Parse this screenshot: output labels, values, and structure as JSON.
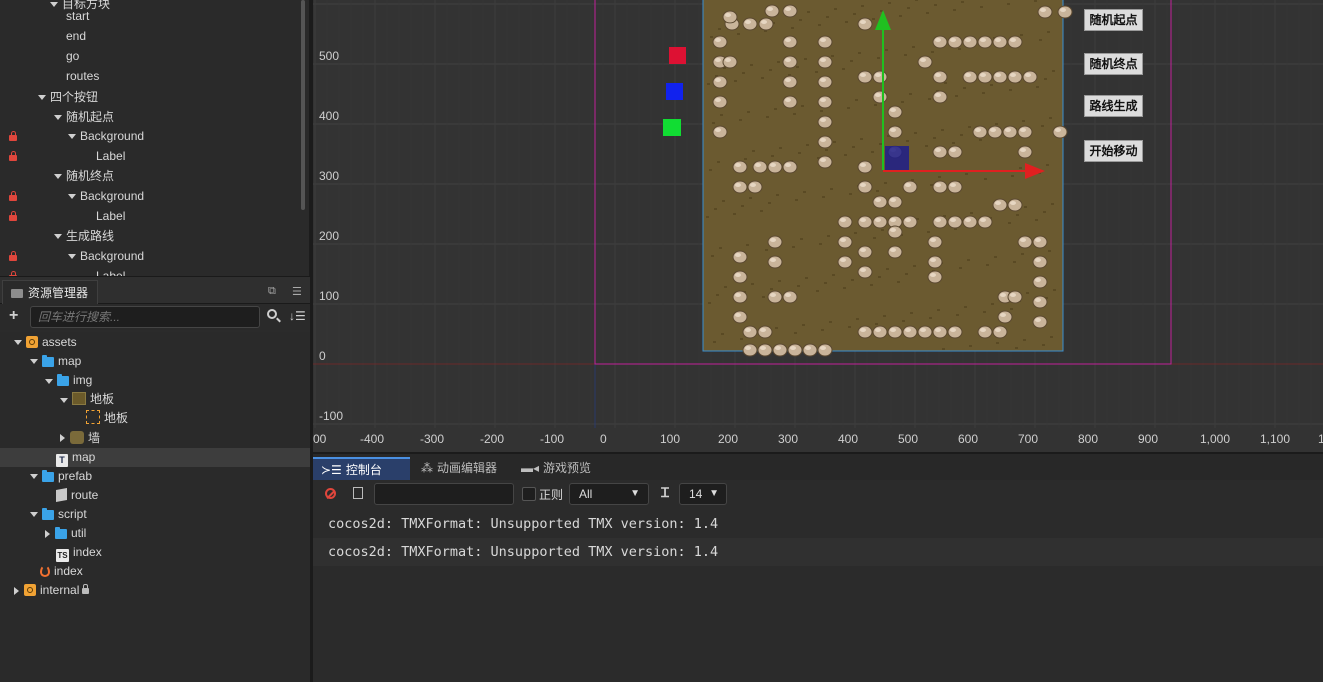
{
  "hierarchy": {
    "rows": [
      {
        "label": "目标方块",
        "indent": 50,
        "expanded": true,
        "locked": false,
        "partial": true
      },
      {
        "label": "start",
        "indent": 66,
        "expanded": null,
        "locked": false
      },
      {
        "label": "end",
        "indent": 66,
        "expanded": null,
        "locked": false
      },
      {
        "label": "go",
        "indent": 66,
        "expanded": null,
        "locked": false
      },
      {
        "label": "routes",
        "indent": 66,
        "expanded": null,
        "locked": false
      },
      {
        "label": "四个按钮",
        "indent": 38,
        "expanded": true,
        "locked": false
      },
      {
        "label": "随机起点",
        "indent": 54,
        "expanded": true,
        "locked": false
      },
      {
        "label": "Background",
        "indent": 68,
        "expanded": true,
        "locked": true
      },
      {
        "label": "Label",
        "indent": 96,
        "expanded": null,
        "locked": true
      },
      {
        "label": "随机终点",
        "indent": 54,
        "expanded": true,
        "locked": false
      },
      {
        "label": "Background",
        "indent": 68,
        "expanded": true,
        "locked": true
      },
      {
        "label": "Label",
        "indent": 96,
        "expanded": null,
        "locked": true
      },
      {
        "label": "生成路线",
        "indent": 54,
        "expanded": true,
        "locked": false
      },
      {
        "label": "Background",
        "indent": 68,
        "expanded": true,
        "locked": true
      },
      {
        "label": "Label",
        "indent": 96,
        "expanded": null,
        "locked": true
      }
    ]
  },
  "assets_panel": {
    "tab_label": "资源管理器",
    "search_placeholder": "回车进行搜索...",
    "rows": [
      {
        "label": "assets",
        "indent": 14,
        "toggle": "open",
        "icon": "package-icon",
        "selected": false,
        "lock": false
      },
      {
        "label": "map",
        "indent": 30,
        "toggle": "open",
        "icon": "folder-icon",
        "selected": false,
        "lock": false
      },
      {
        "label": "img",
        "indent": 45,
        "toggle": "open",
        "icon": "folder-icon",
        "selected": false,
        "lock": false
      },
      {
        "label": "地板",
        "indent": 60,
        "toggle": "open",
        "icon": "image-icon",
        "selected": false,
        "lock": false
      },
      {
        "label": "地板",
        "indent": 86,
        "toggle": null,
        "icon": "sprite-frame-icon",
        "selected": false,
        "lock": false
      },
      {
        "label": "墙",
        "indent": 60,
        "toggle": "closed",
        "icon": "wall-image-icon",
        "selected": false,
        "lock": false
      },
      {
        "label": "map",
        "indent": 46,
        "toggle": null,
        "icon": "tmx-icon",
        "selected": true,
        "lock": false
      },
      {
        "label": "prefab",
        "indent": 30,
        "toggle": "open",
        "icon": "folder-icon",
        "selected": false,
        "lock": false
      },
      {
        "label": "route",
        "indent": 46,
        "toggle": null,
        "icon": "prefab-icon",
        "selected": false,
        "lock": false
      },
      {
        "label": "script",
        "indent": 30,
        "toggle": "open",
        "icon": "folder-icon",
        "selected": false,
        "lock": false
      },
      {
        "label": "util",
        "indent": 45,
        "toggle": "closed",
        "icon": "folder-icon",
        "selected": false,
        "lock": false
      },
      {
        "label": "index",
        "indent": 46,
        "toggle": null,
        "icon": "ts-icon",
        "selected": false,
        "lock": false
      },
      {
        "label": "index",
        "indent": 30,
        "toggle": null,
        "icon": "fire-icon",
        "selected": false,
        "lock": false
      },
      {
        "label": "internal",
        "indent": 14,
        "toggle": "closed",
        "icon": "package-icon",
        "selected": false,
        "lock": true
      }
    ]
  },
  "scene": {
    "y_labels": [
      "500",
      "400",
      "300",
      "200",
      "100",
      "0",
      "-100"
    ],
    "x_labels": [
      "00",
      "-400",
      "-300",
      "-200",
      "-100",
      "0",
      "100",
      "200",
      "300",
      "400",
      "500",
      "600",
      "700",
      "800",
      "900",
      "1,000",
      "1,100",
      "1"
    ],
    "buttons": [
      {
        "label": "随机起点",
        "name": "random-start-button"
      },
      {
        "label": "随机终点",
        "name": "random-end-button"
      },
      {
        "label": "路线生成",
        "name": "generate-route-button"
      },
      {
        "label": "开始移动",
        "name": "start-move-button"
      }
    ],
    "colors": {
      "start": "#dd1133",
      "end": "#1122ee",
      "go": "#11dd33",
      "canvas_border": "#c0209a",
      "map_border": "#3a8fd0",
      "x_axis": "#e02020",
      "y_axis": "#20c020"
    }
  },
  "console": {
    "tabs": [
      "控制台",
      "动画编辑器",
      "游戏预览"
    ],
    "regex_label": "正则",
    "level": "All",
    "font_size": "14",
    "logs": [
      "cocos2d: TMXFormat: Unsupported TMX version: 1.4",
      "cocos2d: TMXFormat: Unsupported TMX version: 1.4"
    ]
  }
}
